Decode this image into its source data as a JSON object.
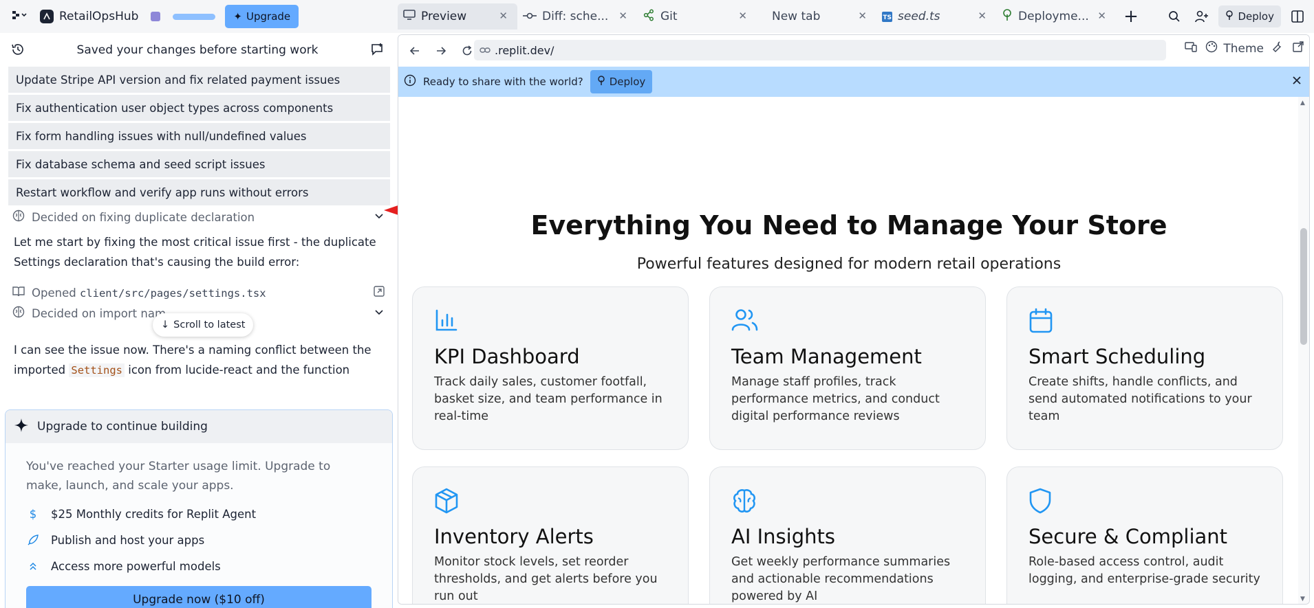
{
  "app": {
    "name": "RetailOpsHub",
    "upgrade_label": "Upgrade"
  },
  "tabs": [
    {
      "label": "Preview",
      "icon": "monitor-icon",
      "active": true
    },
    {
      "label": "Diff: sche...",
      "icon": "commit-icon"
    },
    {
      "label": "Git",
      "icon": "git-branch-icon"
    },
    {
      "label": "New tab",
      "icon": ""
    },
    {
      "label": "seed.ts",
      "icon": "typescript-icon",
      "italic": true
    },
    {
      "label": "Deployme...",
      "icon": "tree-icon"
    }
  ],
  "header_actions": {
    "deploy_label": "Deploy"
  },
  "agent_panel": {
    "header_title": "Saved your changes before starting work",
    "tasks": [
      "Update Stripe API version and fix related payment issues",
      "Fix authentication user object types across components",
      "Fix form handling issues with null/undefined values",
      "Fix database schema and seed script issues",
      "Restart workflow and verify app runs without errors"
    ],
    "decided_1": "Decided on fixing duplicate declaration",
    "paragraph_1": "Let me start by fixing the most critical issue first - the duplicate Settings declaration that's causing the build error:",
    "opened_prefix": "Opened",
    "opened_file": "client/src/pages/settings.tsx",
    "decided_2": "Decided on import nam",
    "scroll_latest": "Scroll to latest",
    "paragraph_2a": "I can see the issue now. There's a naming conflict between the",
    "paragraph_2b_pre": "imported",
    "paragraph_2b_code": "Settings",
    "paragraph_2b_post": "icon from lucide-react and the function"
  },
  "upgrade_card": {
    "title": "Upgrade to continue building",
    "description": "You've reached your Starter usage limit. Upgrade to make, launch, and scale your apps.",
    "items": [
      {
        "icon": "dollar-icon",
        "label": "$25 Monthly credits for Replit Agent"
      },
      {
        "icon": "rocket-icon",
        "label": "Publish and host your apps"
      },
      {
        "icon": "chevrons-up-icon",
        "label": "Access more powerful models"
      }
    ],
    "cta": "Upgrade now ($10 off)"
  },
  "browser": {
    "url": ".replit.dev/",
    "theme_label": "Theme",
    "banner_text": "Ready to share with the world?",
    "banner_deploy": "Deploy"
  },
  "site": {
    "hero_title": "Everything You Need to Manage Your Store",
    "hero_subtitle": "Powerful features designed for modern retail operations",
    "accent_color": "#2196f3",
    "features": [
      {
        "icon": "bar-chart-icon",
        "title": "KPI Dashboard",
        "description": "Track daily sales, customer footfall, basket size, and team performance in real-time"
      },
      {
        "icon": "users-icon",
        "title": "Team Management",
        "description": "Manage staff profiles, track performance metrics, and conduct digital performance reviews"
      },
      {
        "icon": "calendar-icon",
        "title": "Smart Scheduling",
        "description": "Create shifts, handle conflicts, and send automated notifications to your team"
      },
      {
        "icon": "package-icon",
        "title": "Inventory Alerts",
        "description": "Monitor stock levels, set reorder thresholds, and get alerts before you run out"
      },
      {
        "icon": "brain-icon",
        "title": "AI Insights",
        "description": "Get weekly performance summaries and actionable recommendations powered by AI"
      },
      {
        "icon": "shield-icon",
        "title": "Secure & Compliant",
        "description": "Role-based access control, audit logging, and enterprise-grade security"
      }
    ]
  }
}
